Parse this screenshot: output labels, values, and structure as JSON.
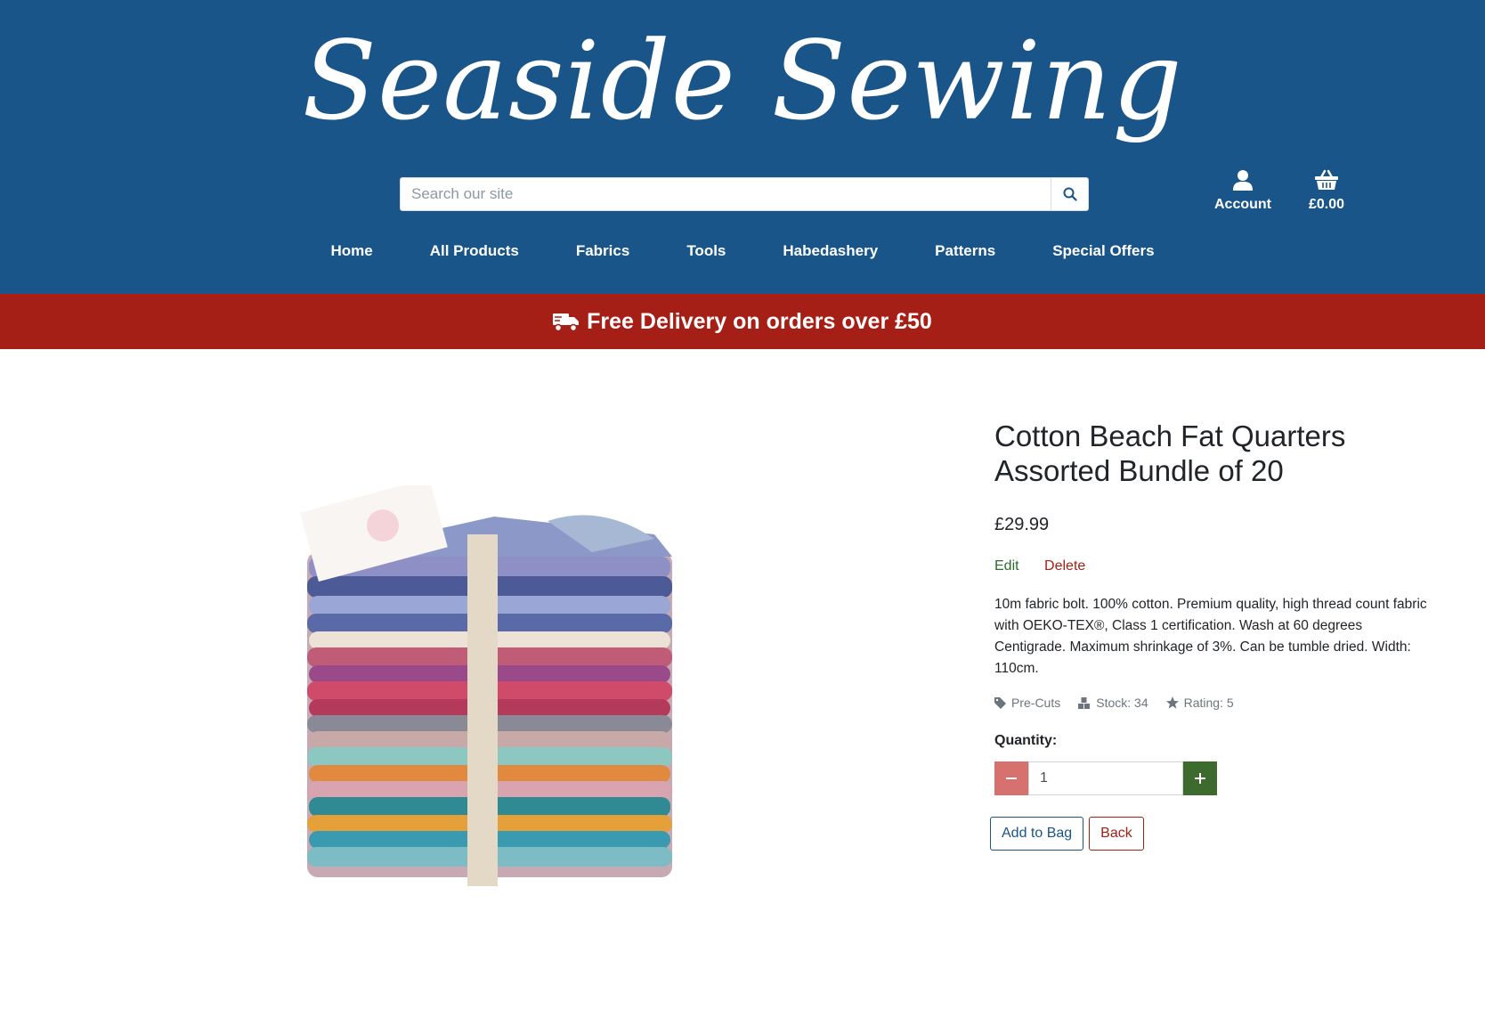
{
  "header": {
    "logo": "Seaside Sewing",
    "search_placeholder": "Search our site",
    "account_label": "Account",
    "bag_total": "£0.00",
    "nav": [
      "Home",
      "All Products",
      "Fabrics",
      "Tools",
      "Habedashery",
      "Patterns",
      "Special Offers"
    ]
  },
  "banner": {
    "text": "Free Delivery on orders over £50"
  },
  "product": {
    "title": "Cotton Beach Fat Quarters Assorted Bundle of 20",
    "price": "£29.99",
    "edit_label": "Edit",
    "delete_label": "Delete",
    "description": "10m fabric bolt. 100% cotton. Premium quality, high thread count fabric with OEKO-TEX®, Class 1 certification. Wash at 60 degrees Centigrade. Maximum shrinkage of 3%. Can be tumble dried. Width: 110cm.",
    "category": "Pre-Cuts",
    "stock": "Stock: 34",
    "rating": "Rating: 5",
    "quantity_label": "Quantity:",
    "quantity_value": "1",
    "add_to_bag_label": "Add to Bag",
    "back_label": "Back"
  },
  "colors": {
    "header_blue": "#195589",
    "banner_red": "#a51f16",
    "edit_green": "#2e6b2b",
    "qty_minus": "#d67170",
    "qty_plus": "#3c6b2d"
  },
  "icons": [
    "search-icon",
    "user-icon",
    "basket-icon",
    "truck-icon",
    "tag-icon",
    "boxes-icon",
    "star-icon",
    "minus-icon",
    "plus-icon"
  ]
}
